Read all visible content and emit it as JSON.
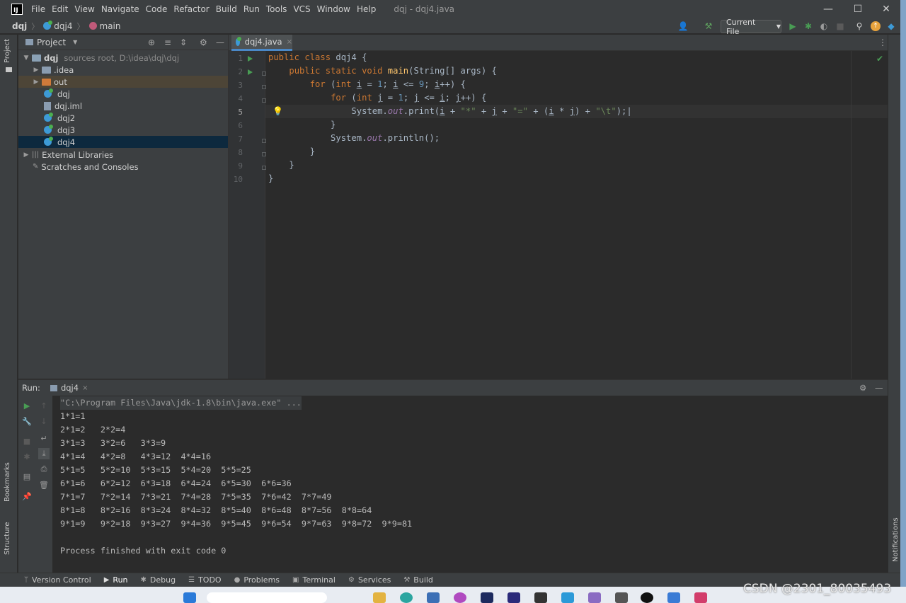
{
  "menu": [
    "File",
    "Edit",
    "View",
    "Navigate",
    "Code",
    "Refactor",
    "Build",
    "Run",
    "Tools",
    "VCS",
    "Window",
    "Help"
  ],
  "window_title": "dqj - dqj4.java",
  "window_controls": [
    "—",
    "☐",
    "✕"
  ],
  "breadcrumb": {
    "project": "dqj",
    "class": "dqj4",
    "method": "main"
  },
  "run_config": "Current File",
  "left_strip": {
    "project_label": "Project",
    "bookmarks_label": "Bookmarks",
    "structure_label": "Structure"
  },
  "project_panel": {
    "title": "Project",
    "items": [
      {
        "label": "dqj",
        "note": "sources root,  D:\\idea\\dqj\\dqj"
      },
      {
        "label": ".idea"
      },
      {
        "label": "out"
      },
      {
        "label": "dqj"
      },
      {
        "label": "dqj.iml"
      },
      {
        "label": "dqj2"
      },
      {
        "label": "dqj3"
      },
      {
        "label": "dqj4"
      },
      {
        "label": "External Libraries"
      },
      {
        "label": "Scratches and Consoles"
      }
    ]
  },
  "editor": {
    "tab": "dqj4.java",
    "line_numbers": [
      "1",
      "2",
      "3",
      "4",
      "5",
      "6",
      "7",
      "8",
      "9",
      "10"
    ]
  },
  "run_panel": {
    "label": "Run:",
    "tab": "dqj4",
    "command": "\"C:\\Program Files\\Java\\jdk-1.8\\bin\\java.exe\" ...",
    "output": [
      "1*1=1",
      "2*1=2   2*2=4",
      "3*1=3   3*2=6   3*3=9",
      "4*1=4   4*2=8   4*3=12  4*4=16",
      "5*1=5   5*2=10  5*3=15  5*4=20  5*5=25",
      "6*1=6   6*2=12  6*3=18  6*4=24  6*5=30  6*6=36",
      "7*1=7   7*2=14  7*3=21  7*4=28  7*5=35  7*6=42  7*7=49",
      "8*1=8   8*2=16  8*3=24  8*4=32  8*5=40  8*6=48  8*7=56  8*8=64",
      "9*1=9   9*2=18  9*3=27  9*4=36  9*5=45  9*6=54  9*7=63  9*8=72  9*9=81",
      "",
      "Process finished with exit code 0"
    ]
  },
  "right_strip": {
    "notifications_label": "Notifications"
  },
  "bottom_bar": [
    "Version Control",
    "Run",
    "Debug",
    "TODO",
    "Problems",
    "Terminal",
    "Services",
    "Build"
  ],
  "watermark": "CSDN @2301_80035493",
  "colors": {
    "background": "#2b2b2b",
    "panel": "#3c3f41",
    "keyword": "#cc7832",
    "method": "#ffc66d",
    "string": "#6a8759",
    "number": "#6897bb",
    "field": "#9876aa",
    "selection": "#0d293e",
    "run_green": "#499c54"
  }
}
